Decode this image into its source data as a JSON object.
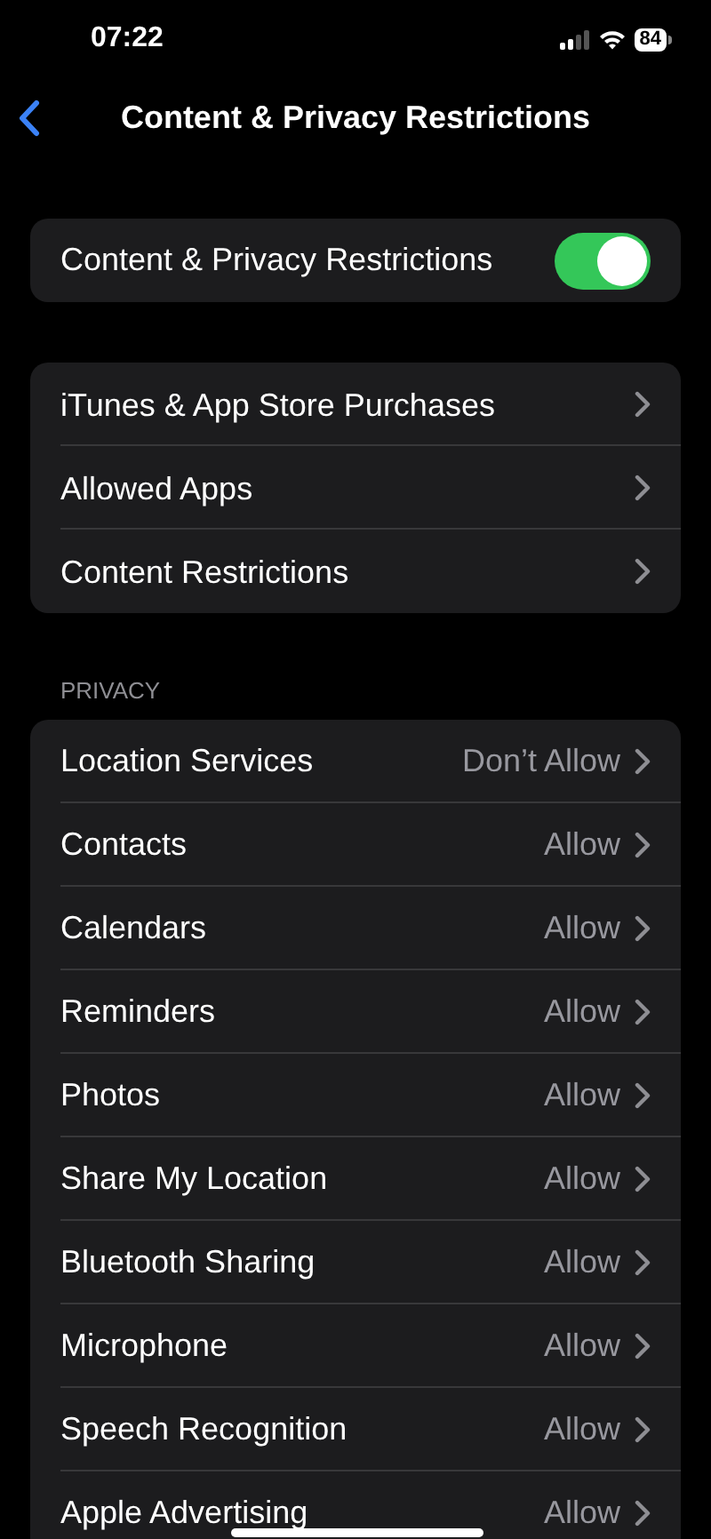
{
  "status_bar": {
    "time": "07:22",
    "battery": "84"
  },
  "nav": {
    "title": "Content & Privacy Restrictions"
  },
  "master_toggle": {
    "label": "Content & Privacy Restrictions",
    "on": true
  },
  "links": [
    {
      "label": "iTunes & App Store Purchases"
    },
    {
      "label": "Allowed Apps"
    },
    {
      "label": "Content Restrictions"
    }
  ],
  "privacy": {
    "header": "PRIVACY",
    "rows": [
      {
        "label": "Location Services",
        "value": "Don’t Allow"
      },
      {
        "label": "Contacts",
        "value": "Allow"
      },
      {
        "label": "Calendars",
        "value": "Allow"
      },
      {
        "label": "Reminders",
        "value": "Allow"
      },
      {
        "label": "Photos",
        "value": "Allow"
      },
      {
        "label": "Share My Location",
        "value": "Allow"
      },
      {
        "label": "Bluetooth Sharing",
        "value": "Allow"
      },
      {
        "label": "Microphone",
        "value": "Allow"
      },
      {
        "label": "Speech Recognition",
        "value": "Allow"
      },
      {
        "label": "Apple Advertising",
        "value": "Allow"
      }
    ]
  }
}
